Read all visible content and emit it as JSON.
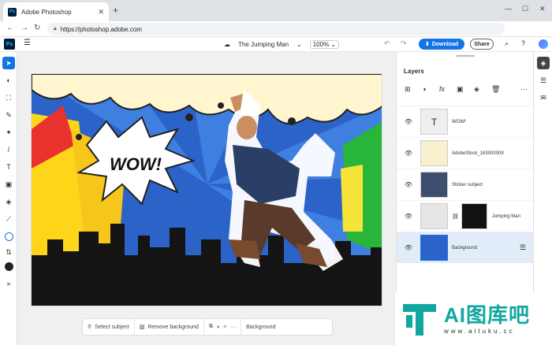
{
  "browser": {
    "tab_title": "Adobe Photoshop",
    "url": "https://photoshop.adobe.com",
    "new_tab": "+",
    "min": "—",
    "max": "☐",
    "close": "✕"
  },
  "app": {
    "logo": "Ps",
    "doc_title": "The Jumping Man",
    "zoom": "100%",
    "download_label": "Download",
    "share_label": "Share"
  },
  "canvas": {
    "caption": "WOW!"
  },
  "layers_panel": {
    "title": "Layers",
    "layers": [
      {
        "name": "WOW!",
        "thumb": "T"
      },
      {
        "name": "AdobeStock_163000009",
        "thumb": ""
      },
      {
        "name": "Sticker subject",
        "thumb": ""
      },
      {
        "name": "Jumping Man",
        "thumb": ""
      },
      {
        "name": "Background",
        "thumb": ""
      }
    ],
    "selected_layer": "Background"
  },
  "bottom_bar": {
    "select_subject": "Select subject",
    "remove_background": "Remove background",
    "background": "Background"
  },
  "watermark": {
    "title": "AI图库吧",
    "subtitle": "www.aituku.cc"
  },
  "colors": {
    "accent": "#1473e6",
    "selected_layer_bg": "#e1ecf8",
    "watermark": "#11a7a0"
  }
}
